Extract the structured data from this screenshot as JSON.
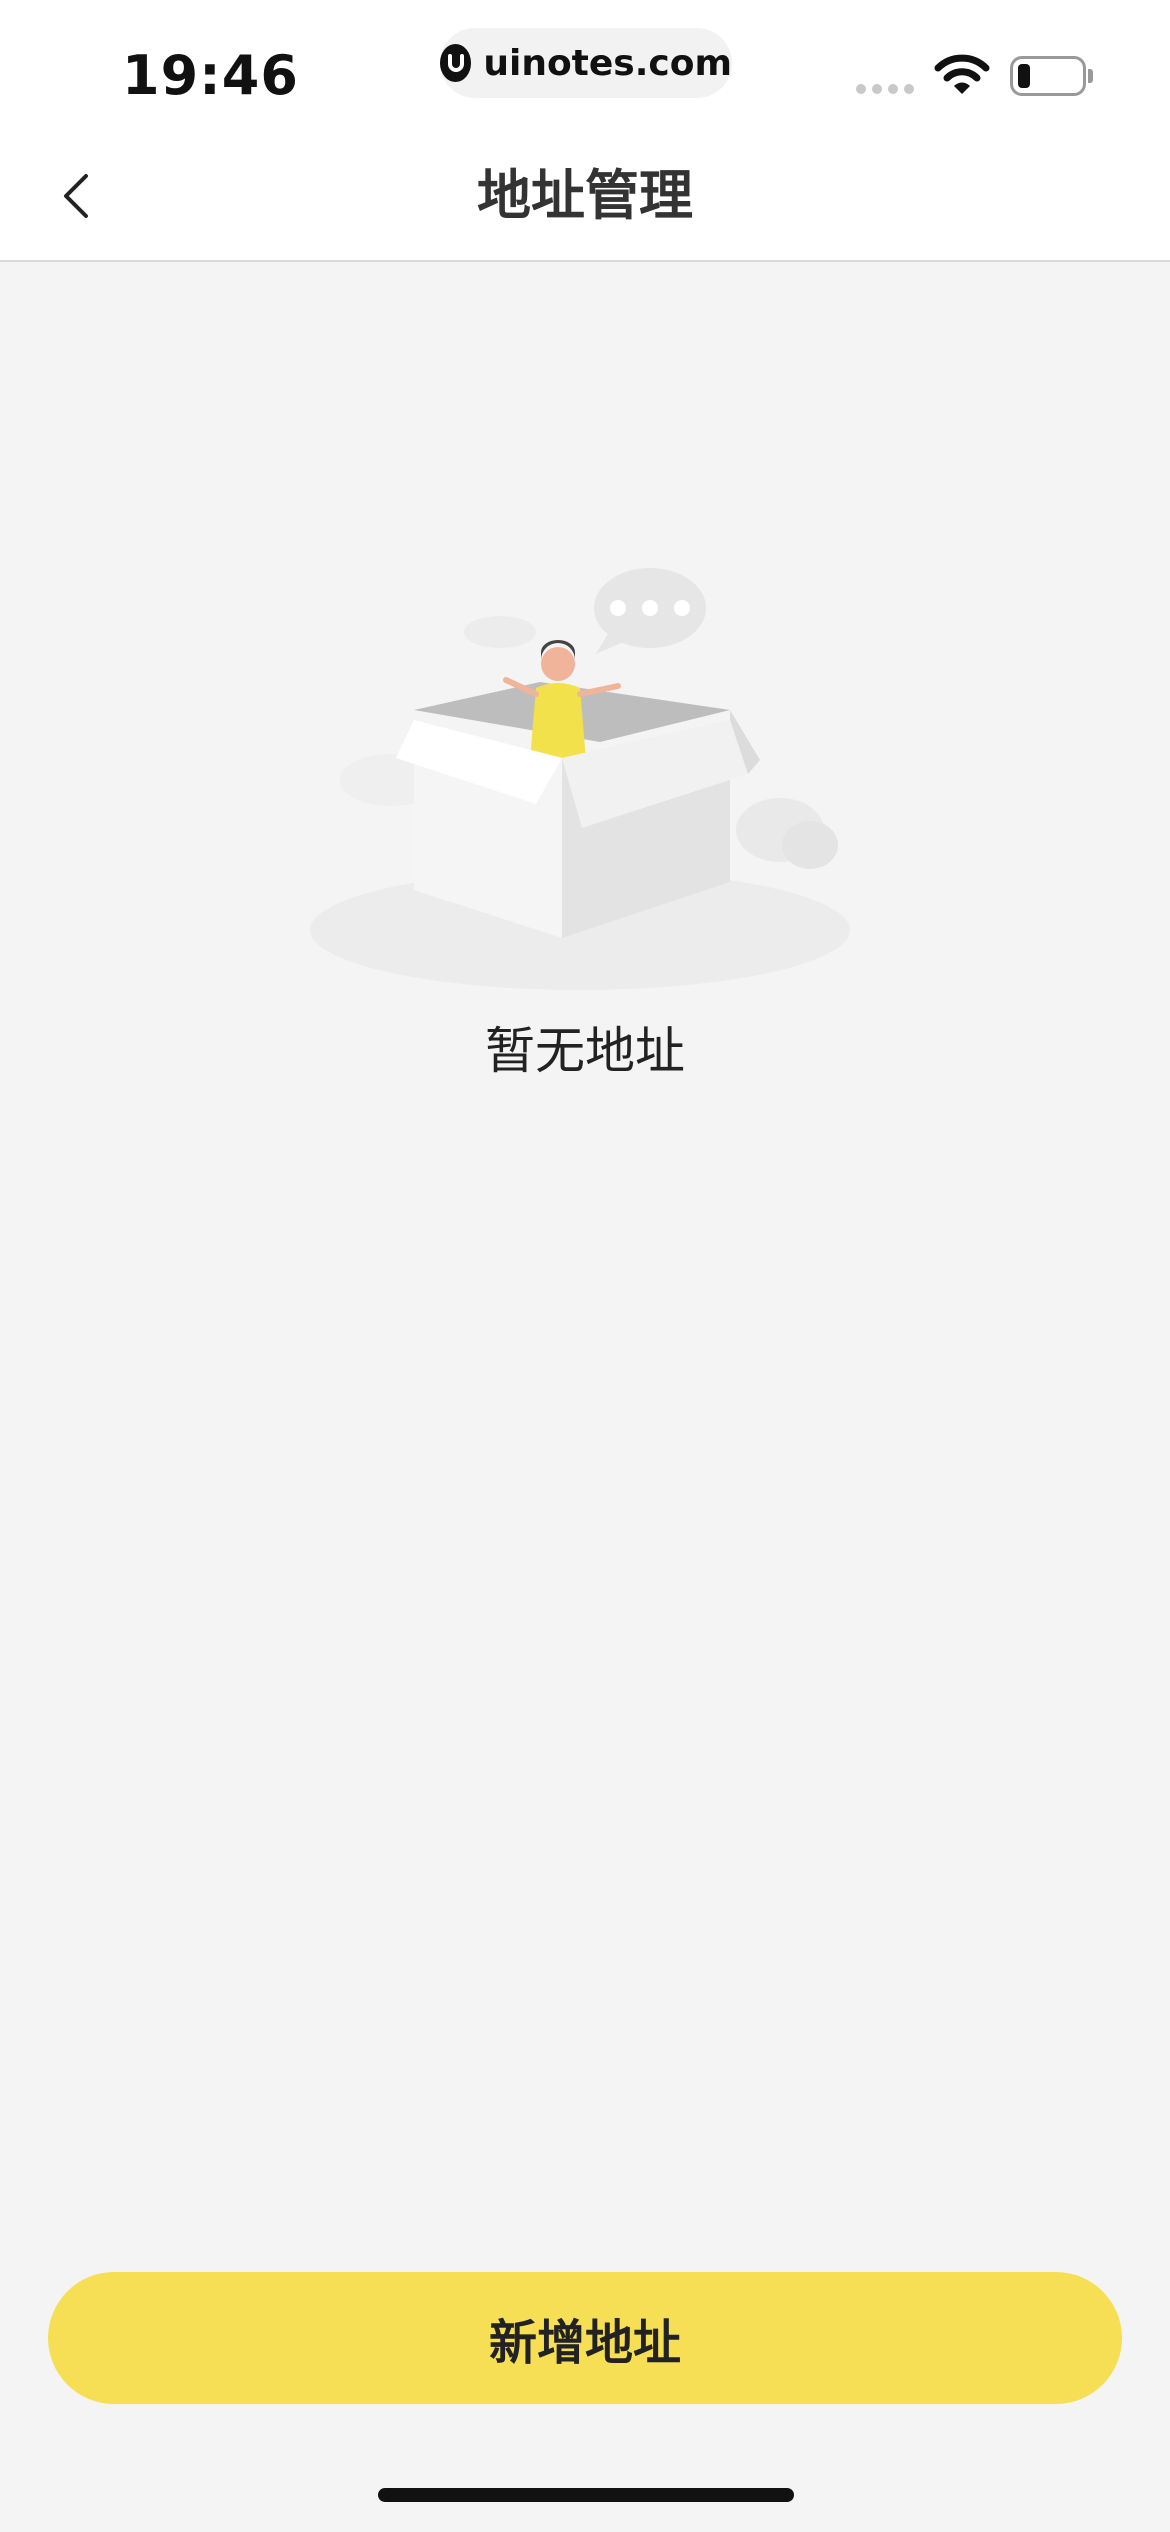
{
  "status_bar": {
    "time": "19:46",
    "url": "uinotes.com"
  },
  "header": {
    "title": "地址管理",
    "back_icon": "chevron-left-icon"
  },
  "empty_state": {
    "illustration": "empty-box-illustration",
    "message": "暂无地址"
  },
  "footer": {
    "add_button_label": "新增地址",
    "accent_color": "#f6df55"
  }
}
